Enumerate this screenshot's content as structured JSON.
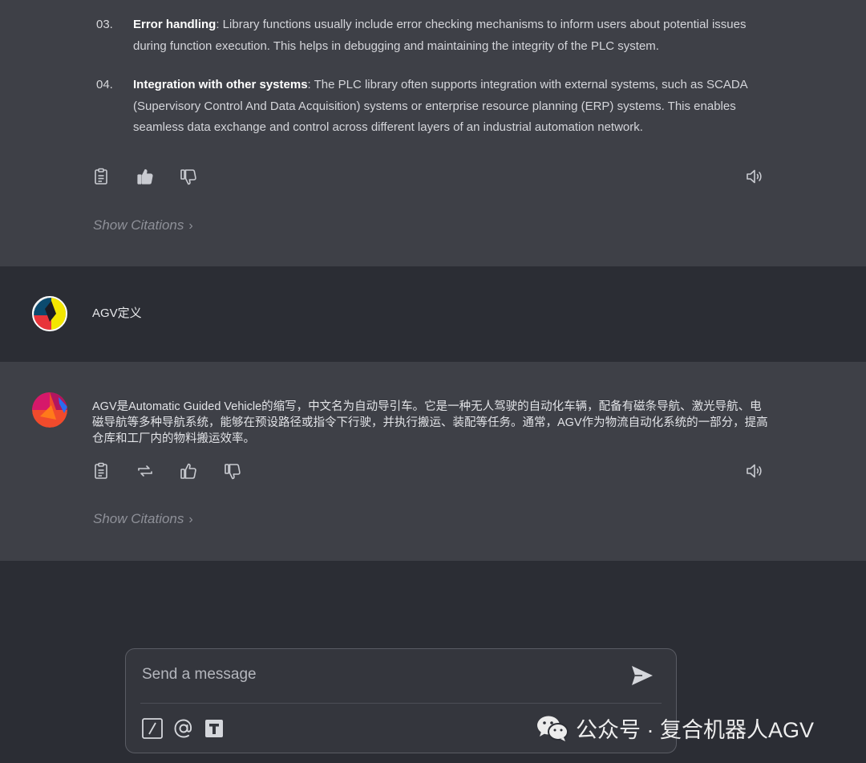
{
  "previous_answer": {
    "items": [
      {
        "number": "03.",
        "title": "Error handling",
        "body": ": Library functions usually include error checking mechanisms to inform users about potential issues during function execution. This helps in debugging and maintaining the integrity of the PLC system."
      },
      {
        "number": "04.",
        "title": "Integration with other systems",
        "body": ": The PLC library often supports integration with external systems, such as SCADA (Supervisory Control And Data Acquisition) systems or enterprise resource planning (ERP) systems. This enables seamless data exchange and control across different layers of an industrial automation network."
      }
    ],
    "actions": [
      "copy-icon",
      "thumbs-up-filled-icon",
      "thumbs-down-icon",
      "speaker-icon"
    ],
    "citations_label": "Show Citations"
  },
  "user_message": {
    "text": "AGV定义"
  },
  "bot_reply": {
    "text": "AGV是Automatic Guided Vehicle的缩写，中文名为自动导引车。它是一种无人驾驶的自动化车辆，配备有磁条导航、激光导航、电磁导航等多种导航系统，能够在预设路径或指令下行驶，并执行搬运、装配等任务。通常，AGV作为物流自动化系统的一部分，提高仓库和工厂内的物料搬运效率。",
    "actions": [
      "copy-icon",
      "regenerate-icon",
      "thumbs-up-icon",
      "thumbs-down-icon",
      "speaker-icon"
    ],
    "citations_label": "Show Citations"
  },
  "composer": {
    "placeholder": "Send a message",
    "value": "",
    "tools": [
      "slash-command-icon",
      "at-mention-icon",
      "text-format-icon"
    ],
    "send_icon": "send-icon"
  },
  "watermark": {
    "text": "公众号 · 复合机器人AGV",
    "icon": "wechat-icon"
  },
  "colors": {
    "page_bg": "#2b2d34",
    "message_bg": "#3e4047",
    "text": "#e6e7ea",
    "muted": "#8e9098"
  }
}
